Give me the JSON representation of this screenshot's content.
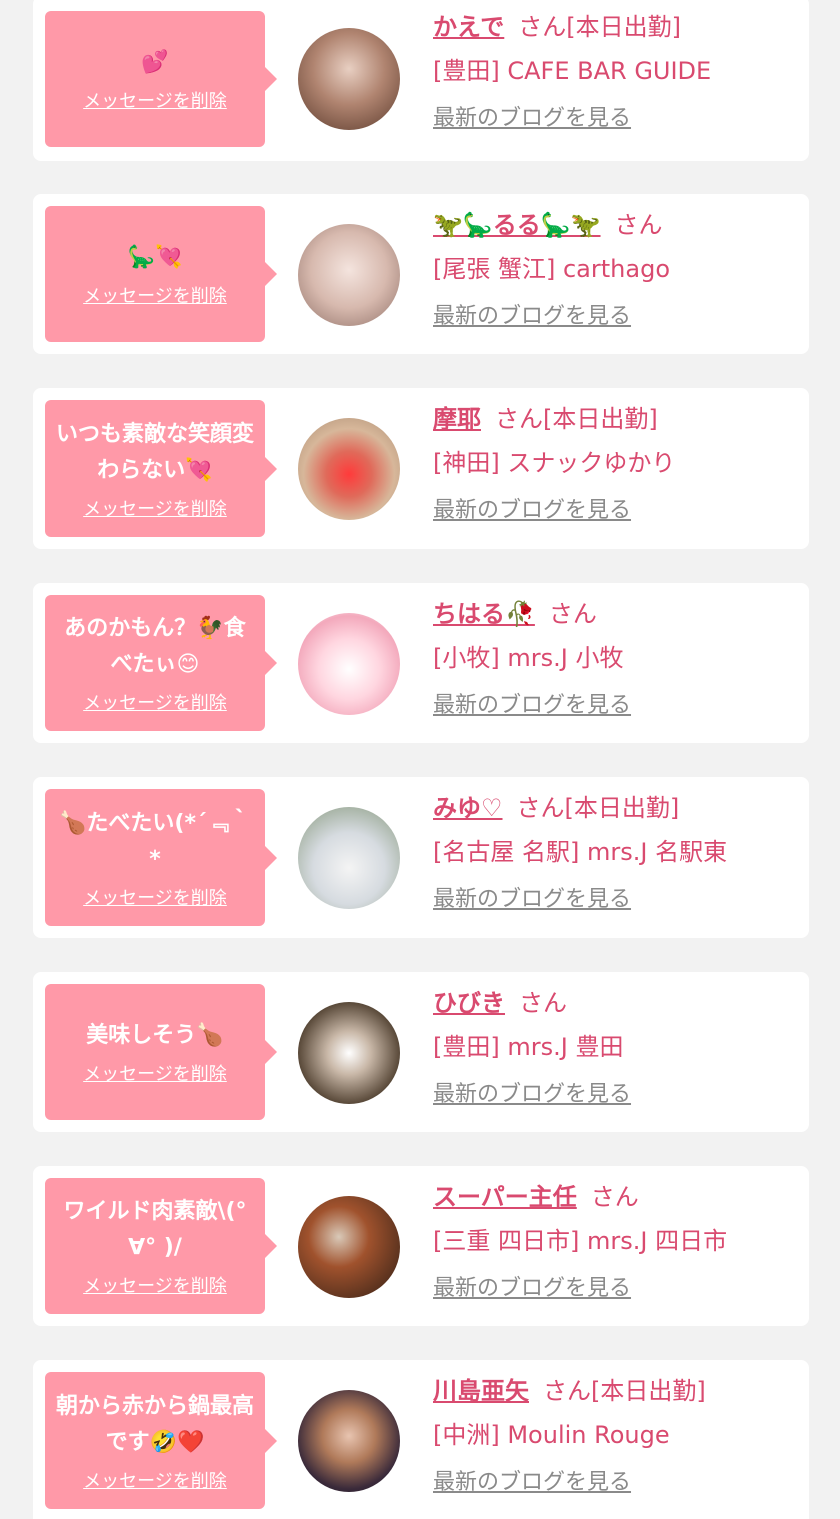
{
  "items": [
    {
      "message": "💕",
      "delete_label": "メッセージを削除",
      "name": "かえで",
      "san": "さん",
      "status": "[本日出勤]",
      "shop": "[豊田] CAFE BAR GUIDE",
      "blog": "最新のブログを見る",
      "avatar_icon": "profile-photo"
    },
    {
      "message": "🦕💘",
      "delete_label": "メッセージを削除",
      "name": "🦖🦕るる🦕🦖",
      "san": "さん",
      "status": "",
      "shop": "[尾張 蟹江] carthago",
      "blog": "最新のブログを見る",
      "avatar_icon": "profile-photo"
    },
    {
      "message": "いつも素敵な笑顔変わらない💘",
      "delete_label": "メッセージを削除",
      "name": "摩耶",
      "san": "さん",
      "status": "[本日出勤]",
      "shop": "[神田] スナックゆかり",
      "blog": "最新のブログを見る",
      "avatar_icon": "profile-photo"
    },
    {
      "message": "あのかもん？🐓食べたぃ😊",
      "delete_label": "メッセージを削除",
      "name": "ちはる🥀",
      "san": "さん",
      "status": "",
      "shop": "[小牧] mrs.J 小牧",
      "blog": "最新のブログを見る",
      "avatar_icon": "profile-photo"
    },
    {
      "message": "🍗たべたい(*´﹃｀*",
      "delete_label": "メッセージを削除",
      "name": "みゆ♡",
      "san": "さん",
      "status": "[本日出勤]",
      "shop": "[名古屋 名駅] mrs.J 名駅東",
      "blog": "最新のブログを見る",
      "avatar_icon": "profile-photo"
    },
    {
      "message": "美味しそう🍗",
      "delete_label": "メッセージを削除",
      "name": "ひびき",
      "san": "さん",
      "status": "",
      "shop": "[豊田] mrs.J 豊田",
      "blog": "最新のブログを見る",
      "avatar_icon": "profile-photo"
    },
    {
      "message": "ワイルド肉素敵\\(°∀° )/",
      "delete_label": "メッセージを削除",
      "name": "スーパー主任",
      "san": "さん",
      "status": "",
      "shop": "[三重 四日市] mrs.J 四日市",
      "blog": "最新のブログを見る",
      "avatar_icon": "profile-photo"
    },
    {
      "message": "朝から赤から鍋最高です🤣❤️",
      "delete_label": "メッセージを削除",
      "name": "川島亜矢",
      "san": "さん",
      "status": "[本日出勤]",
      "shop": "[中洲] Moulin Rouge",
      "blog": "最新のブログを見る",
      "avatar_icon": "profile-photo"
    }
  ]
}
